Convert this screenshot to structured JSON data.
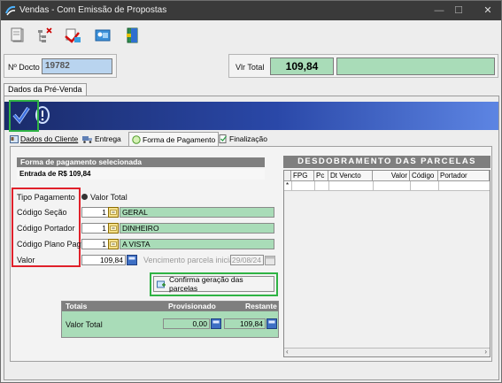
{
  "window": {
    "title": "Vendas - Com Emissão de Propostas"
  },
  "toolbar": {
    "buttons": [
      "clipboard-icon",
      "tree-delete-icon",
      "export-icon",
      "image-icon",
      "exit-icon"
    ]
  },
  "doc": {
    "label": "Nº Docto",
    "value": "19782"
  },
  "total": {
    "label": "Vlr Total",
    "value": "109,84"
  },
  "main_tab": "Dados da Pré-Venda",
  "sub_tabs": [
    "Dados do Cliente",
    "Entrega",
    "Forma de Pagamento",
    "Finalização"
  ],
  "payment": {
    "section_title": "Forma de pagamento selecionada",
    "entry_label": "Entrada de R$ 109,84",
    "tipo_label": "Tipo Pagamento",
    "tipo_option": "Valor Total",
    "secao_label": "Código Seção",
    "secao_code": "1",
    "secao_name": "GERAL",
    "portador_label": "Código Portador",
    "portador_code": "1",
    "portador_name": "DINHEIRO",
    "plano_label": "Código Plano Pagto",
    "plano_code": "1",
    "plano_name": "A VISTA",
    "valor_label": "Valor",
    "valor": "109,84",
    "vencimento_label": "Vencimento parcela inicial",
    "vencimento": "29/08/24",
    "confirm_button": "Confirma geração das parcelas"
  },
  "totals": {
    "title": "Totais",
    "col_provisionado": "Provisionado",
    "col_restante": "Restante",
    "row_label": "Valor Total",
    "provisionado": "0,00",
    "restante": "109,84"
  },
  "parcelas": {
    "title": "Desdobramento das Parcelas",
    "columns": [
      "FPG",
      "Pc",
      "Dt Vencto",
      "Valor",
      "Código",
      "Portador"
    ],
    "row_marker": "*"
  }
}
